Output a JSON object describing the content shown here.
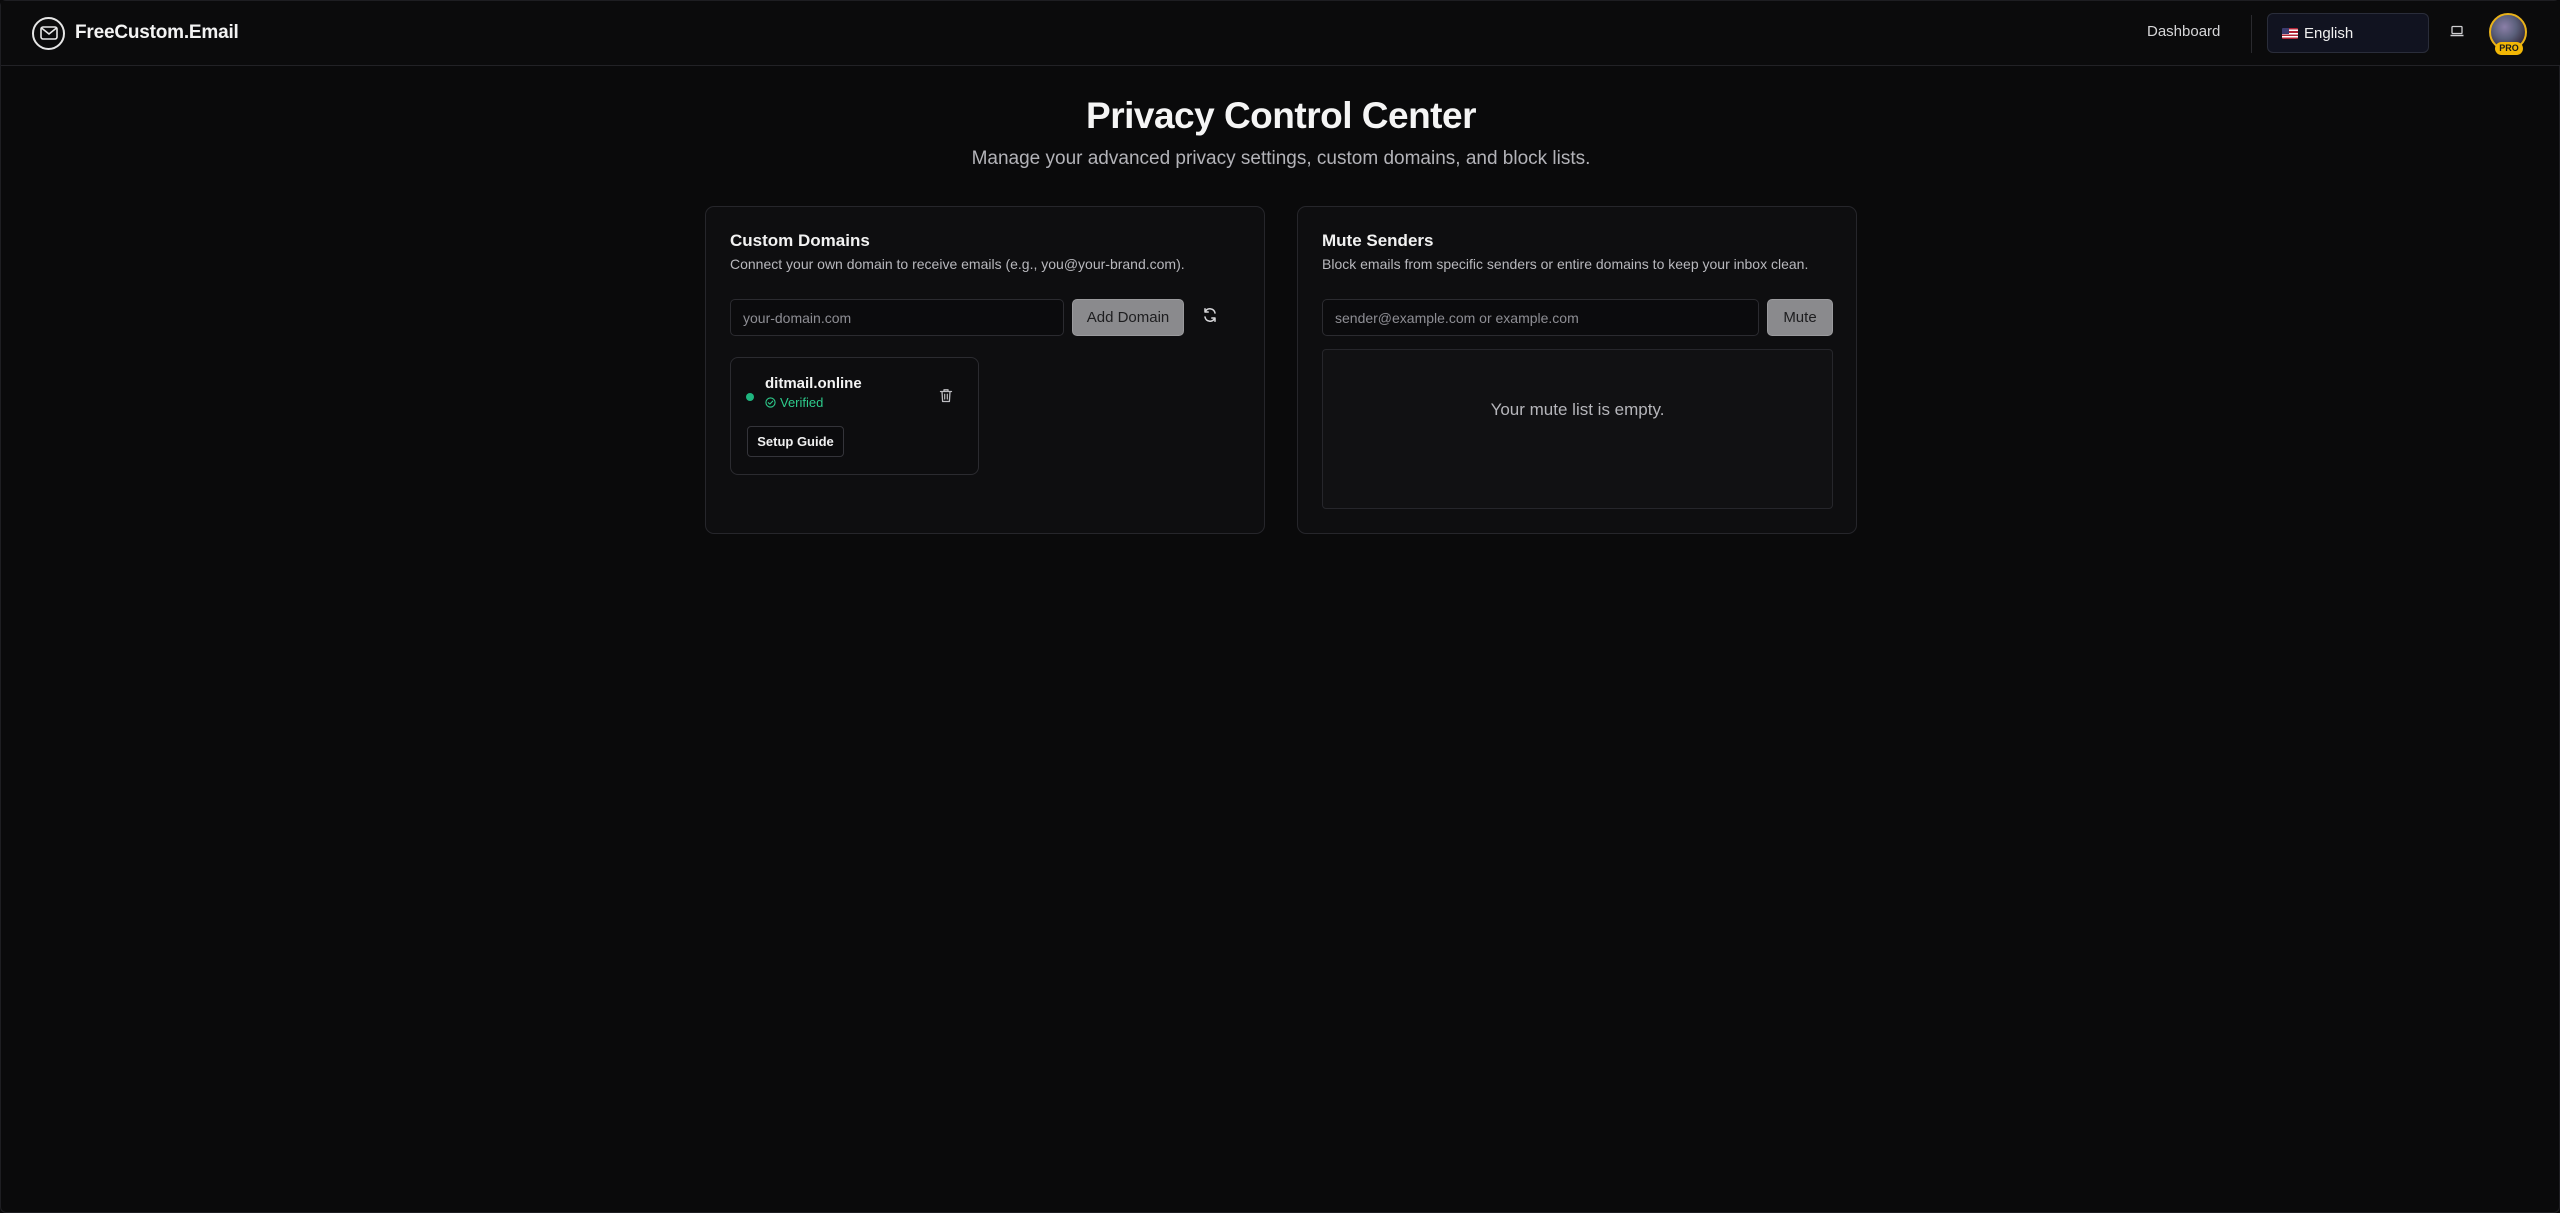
{
  "header": {
    "brand_name": "FreeCustom.Email",
    "nav_dashboard": "Dashboard",
    "language": "English",
    "pro_badge": "PRO"
  },
  "page": {
    "title": "Privacy Control Center",
    "subtitle": "Manage your advanced privacy settings, custom domains, and block lists."
  },
  "custom_domains": {
    "title": "Custom Domains",
    "description": "Connect your own domain to receive emails (e.g., you@your-brand.com).",
    "input_placeholder": "your-domain.com",
    "add_button": "Add Domain",
    "domains": [
      {
        "name": "ditmail.online",
        "status": "Verified",
        "setup_button": "Setup Guide"
      }
    ]
  },
  "mute_senders": {
    "title": "Mute Senders",
    "description": "Block emails from specific senders or entire domains to keep your inbox clean.",
    "input_placeholder": "sender@example.com or example.com",
    "mute_button": "Mute",
    "empty_text": "Your mute list is empty."
  },
  "colors": {
    "background": "#0a0a0b",
    "verified_green": "#2ecb8c",
    "pro_gold": "#f2b705",
    "button_gray": "#8a8a8d"
  },
  "icons": {
    "brand": "mail-icon",
    "language": "us-flag-icon",
    "theme": "laptop-icon",
    "refresh": "refresh-icon",
    "delete": "trash-icon",
    "verified": "check-circle-icon"
  }
}
